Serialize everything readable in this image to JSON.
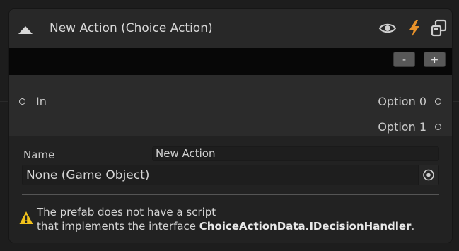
{
  "node": {
    "title": "New Action (Choice Action)",
    "toolbar": {
      "minus_label": "-",
      "plus_label": "+"
    },
    "ports": {
      "inputs": [
        "In"
      ],
      "outputs": [
        "Option 0",
        "Option 1"
      ]
    }
  },
  "inspector": {
    "name_label": "Name",
    "name_value": "New Action",
    "object_field_value": "None (Game Object)",
    "warning": {
      "line1": "The prefab does not have a script",
      "line2_prefix": "that implements the interface ",
      "interface_name": "ChoiceActionData.IDecisionHandler",
      "line2_suffix": "."
    }
  },
  "icons": {
    "collapse": "triangle-up-icon",
    "visibility": "eye-icon",
    "lightning": "bolt-icon",
    "prefab": "prefab-icon",
    "object_picker": "target-icon",
    "warning": "warning-triangle-icon"
  },
  "colors": {
    "bolt": "#e8922a",
    "warning": "#f2c21b",
    "canvas": "#1d1d1d",
    "node_body": "#2a2a2a",
    "toolbar": "#070707"
  }
}
